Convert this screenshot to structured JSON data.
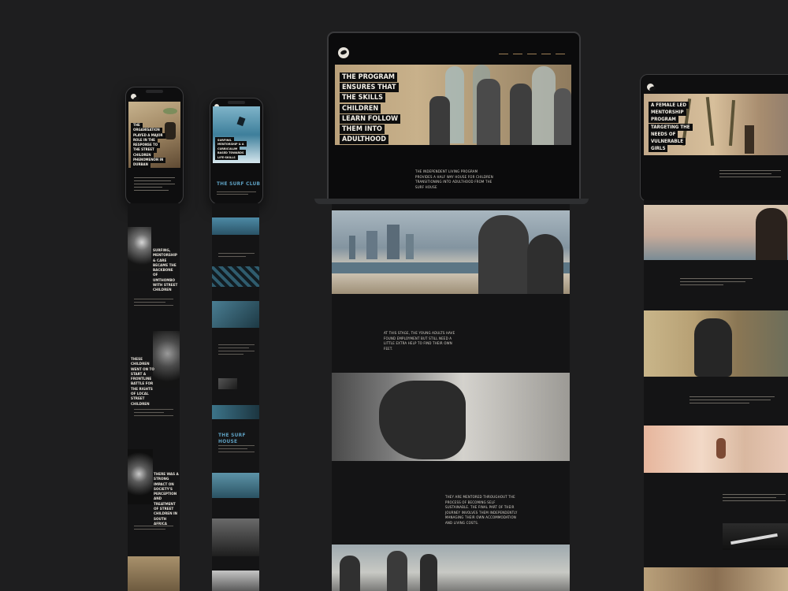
{
  "phone1": {
    "hero": "THE ORGANISATION PLAYED A MAJOR ROLE IN THE RESPONSE TO THE STREET CHILDREN PHENOMENON IN DURBAN",
    "section_a": "SURFING, MENTORSHIP & CARE BECAME THE BACKBONE OF UMTHOMBO WITH STREET CHILDREN",
    "section_b": "THESE CHILDREN WENT ON TO START A FRONTLINE BATTLE FOR THE RIGHTS OF LOCAL STREET CHILDREN",
    "section_c": "THERE WAS A STRONG IMPACT ON SOCIETY'S PERCEPTION AND TREATMENT OF STREET CHILDREN IN SOUTH AFRICA"
  },
  "phone2": {
    "hero": "SURFING, MENTORSHIP & A CURRICULUM BASED TOWARDS LIFE-SKILLS",
    "surf_club": "THE SURF CLUB",
    "surf_house": "THE SURF HOUSE"
  },
  "laptop": {
    "hero_title": "THE PROGRAM ENSURES THAT THE SKILLS CHILDREN LEARN FOLLOW THEM INTO ADULTHOOD",
    "intro": "THE INDEPENDENT LIVING PROGRAM PROVIDES A HALF WAY HOUSE FOR CHILDREN TRANSITIONING INTO ADULTHOOD FROM THE SURF HOUSE",
    "stage_text": "AT THIS STAGE, THE YOUNG ADULTS HAVE FOUND EMPLOYMENT BUT STILL NEED A LITTLE EXTRA HELP TO FIND THEIR OWN FEET.",
    "mentored_text": "THEY ARE MENTORED THROUGHOUT THE PROCESS OF BECOMING SELF SUSTAINABLE. THE FINAL PART OF THEIR JOURNEY INVOLVES THEM INDEPENDENTLY MANAGING THEIR OWN ACCOMMODATION AND LIVING COSTS."
  },
  "tablet": {
    "hero_title": "A FEMALE LED MENTORSHIP PROGRAM TARGETING THE NEEDS OF VULNERABLE GIRLS"
  },
  "colors": {
    "background": "#1e1e1f",
    "accent_teal": "#5d9fc0",
    "sepia": "#b9a07a"
  }
}
